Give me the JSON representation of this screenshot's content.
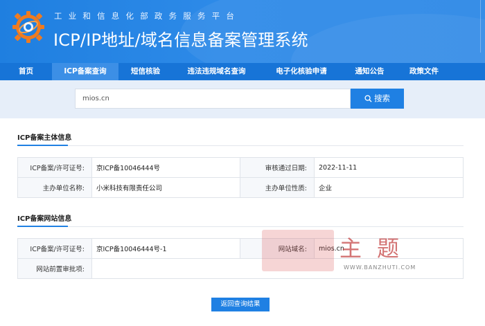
{
  "header": {
    "subtitle": "工业和信息化部政务服务平台",
    "title": "ICP/IP地址/域名信息备案管理系统"
  },
  "nav": {
    "items": [
      {
        "label": "首页"
      },
      {
        "label": "ICP备案查询",
        "active": true
      },
      {
        "label": "短信核验"
      },
      {
        "label": "违法违规域名查询"
      },
      {
        "label": "电子化核验申请"
      },
      {
        "label": "通知公告"
      },
      {
        "label": "政策文件"
      }
    ]
  },
  "search": {
    "value": "mios.cn",
    "button_label": "搜索"
  },
  "subject_section": {
    "title": "ICP备案主体信息",
    "rows": [
      {
        "label1": "ICP备案/许可证号:",
        "value1": "京ICP备10046444号",
        "label2": "审核通过日期:",
        "value2": "2022-11-11"
      },
      {
        "label1": "主办单位名称:",
        "value1": "小米科技有限责任公司",
        "label2": "主办单位性质:",
        "value2": "企业"
      }
    ]
  },
  "website_section": {
    "title": "ICP备案网站信息",
    "rows": [
      {
        "label1": "ICP备案/许可证号:",
        "value1": "京ICP备10046444号-1",
        "label2": "网站域名:",
        "value2": "mios.cn"
      },
      {
        "label1": "网站前置审批项:",
        "value1": "",
        "label2": "",
        "value2": ""
      }
    ]
  },
  "watermark": {
    "chars": "主题",
    "url": "WWW.BANZHUTI.COM"
  },
  "back_button_label": "返回查询结果",
  "colors": {
    "primary": "#1f80e3",
    "nav": "#1774d7",
    "nav_active": "#3c8fe6",
    "search_band": "#e6eef9"
  }
}
